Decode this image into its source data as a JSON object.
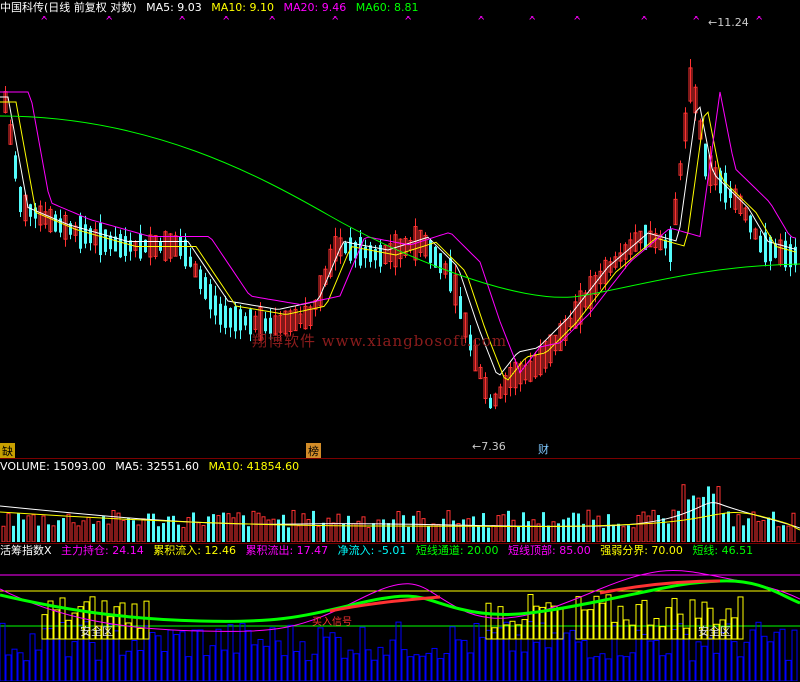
{
  "header": {
    "title": "中国科传(日线 前复权 对数)",
    "ma": [
      {
        "label": "MA5: 9.03",
        "color": "#ffffff"
      },
      {
        "label": "MA10: 9.10",
        "color": "#ffff00"
      },
      {
        "label": "MA20: 9.46",
        "color": "#ff00ff"
      },
      {
        "label": "MA60: 8.81",
        "color": "#00ff00"
      }
    ]
  },
  "price_chart": {
    "high_marker": "11.24",
    "low_marker": "7.36",
    "watermark": "翔博软件 www.xiangbosoft.com",
    "event_tags": [
      "缺",
      "榜",
      "财"
    ]
  },
  "volume": {
    "legend": [
      {
        "label": "VOLUME: 15093.00",
        "color": "#ffffff"
      },
      {
        "label": "MA5: 32551.60",
        "color": "#ffffff"
      },
      {
        "label": "MA10: 41854.60",
        "color": "#ffff00"
      }
    ]
  },
  "indicator": {
    "legend": [
      {
        "label": "活筹指数X",
        "color": "#ffffff"
      },
      {
        "label": "主力持仓: 24.14",
        "color": "#ff00ff"
      },
      {
        "label": "累积流入: 12.46",
        "color": "#ffff00"
      },
      {
        "label": "累积流出: 17.47",
        "color": "#ff00ff"
      },
      {
        "label": "净流入: -5.01",
        "color": "#00ffff"
      },
      {
        "label": "短线通道: 20.00",
        "color": "#00ff00"
      },
      {
        "label": "短线顶部: 85.00",
        "color": "#ff00ff"
      },
      {
        "label": "强弱分界: 70.00",
        "color": "#ffff00"
      },
      {
        "label": "短线: 46.51",
        "color": "#00ff00"
      }
    ],
    "zone_labels": [
      "安全区",
      "安全区"
    ],
    "signal_label": "买入信号"
  },
  "colors": {
    "up": "#ff3232",
    "down": "#54fcfc",
    "ma5": "#ffffff",
    "ma10": "#ffff00",
    "ma20": "#ff00ff",
    "ma60": "#00ff00",
    "grid": "#7a0000"
  }
}
